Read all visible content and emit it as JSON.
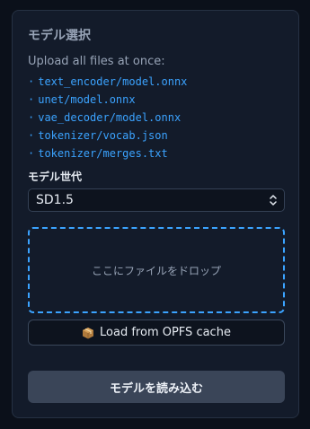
{
  "panel": {
    "title": "モデル選択",
    "upload_hint": "Upload all files at once:",
    "bullet": "·",
    "files": [
      "text_encoder/model.onnx",
      "unet/model.onnx",
      "vae_decoder/model.onnx",
      "tokenizer/vocab.json",
      "tokenizer/merges.txt"
    ],
    "generation_label": "モデル世代",
    "generation_select": {
      "value": "SD1.5"
    },
    "dropzone_text": "ここにファイルをドロップ",
    "opfs_button": {
      "icon": "package-icon",
      "label": "Load from OPFS cache"
    },
    "load_button_label": "モデルを読み込む"
  },
  "colors": {
    "background": "#0b101a",
    "panel": "#131b2a",
    "accent": "#3ba3ff",
    "muted_text": "#97a3b6",
    "primary_button": "#3a4558"
  }
}
